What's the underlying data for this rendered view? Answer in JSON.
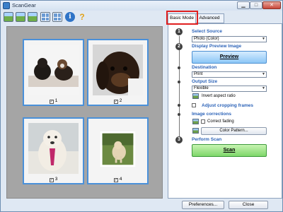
{
  "window": {
    "title": "ScanGear",
    "minimize": "▁",
    "maximize": "□",
    "close": "✕"
  },
  "toolbar": {
    "icons": [
      "crop-image-icon",
      "trim-image-icon",
      "preview-image-icon",
      "thumbnail-view-icon",
      "multi-view-icon",
      "info-icon",
      "help-icon"
    ],
    "info_glyph": "i",
    "help_glyph": "?"
  },
  "preview": {
    "thumbnails": [
      {
        "number": "1",
        "checked": "✓"
      },
      {
        "number": "2",
        "checked": "✓"
      },
      {
        "number": "3",
        "checked": "✓"
      },
      {
        "number": "4",
        "checked": "✓"
      }
    ]
  },
  "tabs": {
    "basic": "Basic Mode",
    "advanced": "Advanced Mode"
  },
  "panel": {
    "step1": {
      "num": "1",
      "title": "Select Source",
      "value": "Photo (Color)"
    },
    "step2": {
      "num": "2",
      "title": "Display Preview Image",
      "button": "Preview"
    },
    "destination": {
      "title": "Destination",
      "value": "Print"
    },
    "output_size": {
      "title": "Output Size",
      "value": "Flexible",
      "invert": "Invert aspect ratio"
    },
    "adjust_frames": "Adjust cropping frames",
    "image_corrections": {
      "title": "Image corrections",
      "correct_fading": "Correct fading",
      "color_pattern": "Color Pattern..."
    },
    "step3": {
      "num": "3",
      "title": "Perform Scan",
      "button": "Scan"
    }
  },
  "footer": {
    "preferences": "Preferences...",
    "close": "Close"
  },
  "colors": {
    "accent_title": "#2c63b8",
    "tab_highlight": "#e02020",
    "scan_button": "#7ed66a",
    "preview_button": "#8cc6f6"
  }
}
